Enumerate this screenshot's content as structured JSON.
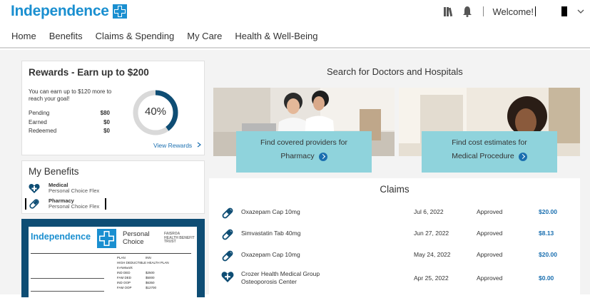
{
  "header": {
    "logo": "Independence",
    "welcome": "Welcome!"
  },
  "nav": [
    {
      "label": "Home"
    },
    {
      "label": "Benefits"
    },
    {
      "label": "Claims & Spending"
    },
    {
      "label": "My Care"
    },
    {
      "label": "Health & Well-Being"
    }
  ],
  "rewards": {
    "title": "Rewards - Earn up to $200",
    "description": "You can earn up to $120 more to reach your goal!",
    "rows": [
      {
        "label": "Pending",
        "value": "$80"
      },
      {
        "label": "Earned",
        "value": "$0"
      },
      {
        "label": "Redeemed",
        "value": "$0"
      }
    ],
    "progress_label": "40%",
    "progress_fraction": 0.4,
    "link": "View Rewards",
    "accent": "#0e4d74"
  },
  "benefits": {
    "title": "My Benefits",
    "items": [
      {
        "name": "Medical",
        "plan": "Personal Choice Flex",
        "icon": "heart-plus-icon"
      },
      {
        "name": "Pharmacy",
        "plan": "Personal Choice Flex",
        "icon": "pill-icon"
      }
    ]
  },
  "id_card": {
    "brand": "Independence",
    "product_line1": "Personal",
    "product_line2": "Choice",
    "partner_line1": "FAISROA",
    "partner_line2": "HEALTH BENEFIT TRUST",
    "plan_header": [
      "PLAN",
      "INN"
    ],
    "plan_name": "HIGH DEDUCTIBLE HEALTH PLAN",
    "in_network": "In-Network",
    "rows": [
      {
        "k": "IND DED",
        "v": "$2500"
      },
      {
        "k": "FAM DED",
        "v": "$5000"
      },
      {
        "k": "IND OOP",
        "v": "$6350"
      },
      {
        "k": "FAM OOP",
        "v": "$12700"
      }
    ]
  },
  "search": {
    "title": "Search for Doctors and Hospitals",
    "cards": [
      {
        "line1": "Find covered providers for",
        "link": "Pharmacy"
      },
      {
        "line1": "Find cost estimates for",
        "link": "Medical Procedure"
      }
    ]
  },
  "claims": {
    "title": "Claims",
    "rows": [
      {
        "name": "Oxazepam Cap 10mg",
        "name2": "",
        "date": "Jul 6, 2022",
        "status": "Approved",
        "amount": "$20.00",
        "icon": "pill-icon"
      },
      {
        "name": "Simvastatin Tab 40mg",
        "name2": "",
        "date": "Jun 27, 2022",
        "status": "Approved",
        "amount": "$8.13",
        "icon": "pill-icon"
      },
      {
        "name": "Oxazepam Cap 10mg",
        "name2": "",
        "date": "May 24, 2022",
        "status": "Approved",
        "amount": "$20.00",
        "icon": "pill-icon"
      },
      {
        "name": "Crozer Health Medical Group",
        "name2": "Osteoporosis Center",
        "date": "Apr 25, 2022",
        "status": "Approved",
        "amount": "$0.00",
        "icon": "heart-plus-icon"
      }
    ]
  },
  "colors": {
    "brand_blue": "#1a8fd0",
    "navy": "#0e4d74",
    "cta_teal": "#8fd3dc",
    "link_blue": "#1a6fb0"
  }
}
